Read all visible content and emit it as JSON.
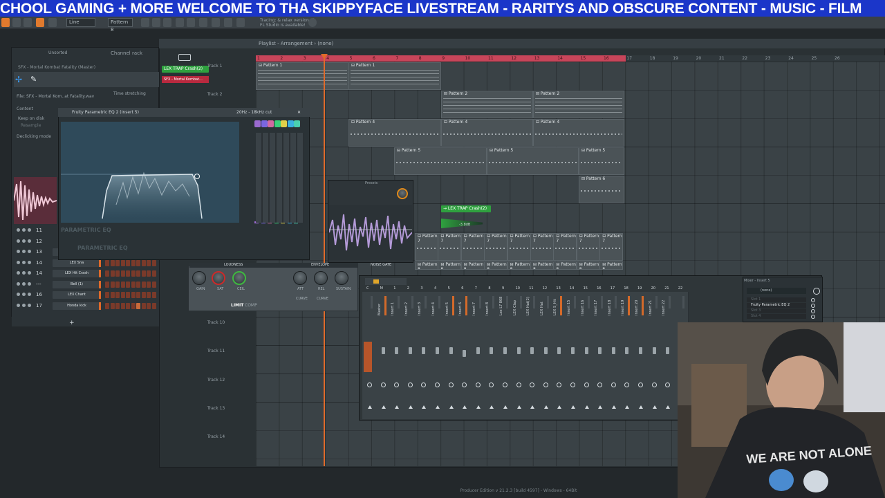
{
  "ticker": {
    "text": "CHOOL GAMING + MORE  WELCOME TO THA SKIPPYFACE LIVESTREAM  - RARITYS AND OBSCURE CONTENT - MUSIC - FILM"
  },
  "toolbar": {
    "mode_value": "Line",
    "pattern_value": "Pattern 8",
    "hint_line1": "Tracing: & relax version pl",
    "hint_line2": "FL Studio is available!"
  },
  "browser": {
    "channel_rack_label": "Channel rack",
    "filter_label": "Unsorted",
    "sample_title": "SFX - Mortal Kombat Fatality (Master)",
    "file_label": "File: SFX - Mortal Kom..at Fatality.wav",
    "time_stretching_label": "Time stretching",
    "content_label": "Content",
    "keep_on_disk_label": "Keep on disk",
    "resample_label": "Resample",
    "declicking_label": "Declicking mode"
  },
  "channel_rack": {
    "rows": [
      {
        "num": "11",
        "name": ""
      },
      {
        "num": "12",
        "name": ""
      },
      {
        "num": "13",
        "name": "LEX Sna"
      },
      {
        "num": "14",
        "name": "LEX Sna"
      },
      {
        "num": "14",
        "name": "LEX Hit Crash"
      },
      {
        "num": "---",
        "name": "Bell (1)"
      },
      {
        "num": "16",
        "name": "LEX Chant"
      },
      {
        "num": "17",
        "name": "Honda kick"
      }
    ],
    "add_label": "+"
  },
  "playlist": {
    "title": "Playlist - Arrangement › (none)",
    "active_clips": [
      "LEX TRAP Crash(2)",
      "SFX - Mortal Kombat..."
    ],
    "tracks": [
      "Track 1",
      "Track 2",
      "Track 10",
      "Track 11",
      "Track 12",
      "Track 13",
      "Track 14"
    ],
    "ruler_numbers": [
      "1",
      "2",
      "3",
      "4",
      "5",
      "6",
      "7",
      "8",
      "9",
      "10",
      "11",
      "12",
      "13",
      "14",
      "15",
      "16",
      "17",
      "18",
      "19",
      "20",
      "21",
      "22",
      "23",
      "24",
      "25",
      "26"
    ],
    "clip_crash": "→ LEX TRAP Crash(2)",
    "clip_vol": "-3.8dB"
  },
  "eq": {
    "title": "Fruity Parametric EQ 2 (Insert 5)",
    "range": "20Hz - 18kHz cut",
    "label": "PARAMETRIC EQ",
    "label2": "PARAMETRIC EQ"
  },
  "limiter": {
    "loudness_label": "LOUDNESS",
    "envelope_label": "ENVELOPE",
    "noise_gate_label": "NOISE GATE",
    "gain_label": "GAIN",
    "sat_label": "SAT",
    "ceil_label": "CEIL",
    "att_label": "ATT",
    "rel_label": "REL",
    "sustain_label": "SUSTAIN",
    "limit_label": "LIMIT",
    "comp_label": "COMP",
    "curve_label": "CURVE"
  },
  "presets": {
    "label": "Presets"
  },
  "mixer": {
    "inserts": [
      "Master",
      "Insert 1",
      "Insert 2",
      "Insert 3",
      "Insert 4",
      "Insert 5",
      "Insert 6",
      "Insert 7",
      "Insert 8",
      "Lex L7 808",
      "LEX Clap",
      "LEX Hat(2)",
      "LEX Hat",
      "LEX S_Hit",
      "Insert 15",
      "Insert 16",
      "Insert 17",
      "Insert 18",
      "Insert 19",
      "Insert 20",
      "Insert 21",
      "Insert 22"
    ],
    "numbers": [
      "C",
      "M",
      "1",
      "2",
      "3",
      "4",
      "5",
      "6",
      "7",
      "8",
      "9",
      "10",
      "11",
      "12",
      "13",
      "14",
      "15",
      "16",
      "17",
      "18",
      "19",
      "20",
      "21",
      "22"
    ],
    "panel_title": "Mixer - Insert 5",
    "panel_preset": "(none)",
    "panel_slots": [
      "Slot 1",
      "Fruity Parametric EQ 2",
      "Slot 3",
      "Slot 4"
    ]
  },
  "status": {
    "text": "Producer Edition v 21.2.3 [build 4597] - Windows - 64Bit"
  },
  "colors": {
    "ticker_bg": "#1b36c9",
    "accent_orange": "#e06a2a",
    "ruler_red": "#c8455a",
    "clip_green": "#2fa13f"
  }
}
